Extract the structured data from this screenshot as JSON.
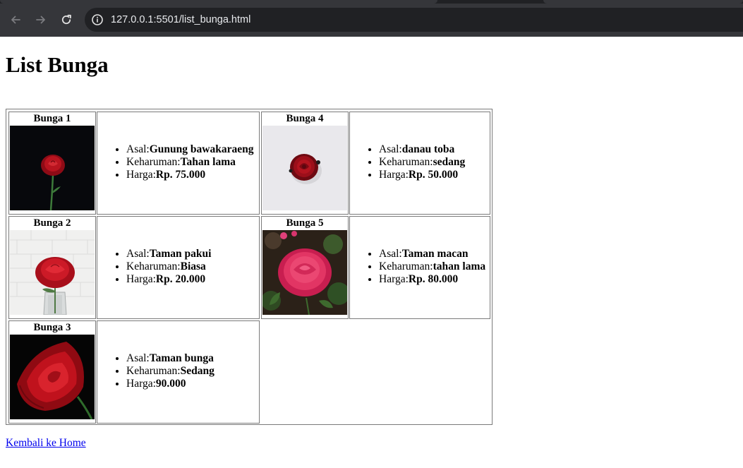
{
  "browser": {
    "url": "127.0.0.1:5501/list_bunga.html"
  },
  "page": {
    "title": "List Bunga",
    "home_link": "Kembali ke Home"
  },
  "labels": {
    "origin": "Asal:",
    "fragrance": "Keharuman:",
    "price": "Harga:"
  },
  "flowers": [
    {
      "name": "Bunga 1",
      "origin": "Gunung bawakaraeng",
      "fragrance": "Tahan lama",
      "price": "Rp. 75.000"
    },
    {
      "name": "Bunga 2",
      "origin": "Taman pakui",
      "fragrance": "Biasa",
      "price": "Rp. 20.000"
    },
    {
      "name": "Bunga 3",
      "origin": "Taman bunga",
      "fragrance": "Sedang",
      "price": "90.000"
    },
    {
      "name": "Bunga 4",
      "origin": "danau toba",
      "fragrance": "sedang",
      "price": "Rp. 50.000"
    },
    {
      "name": "Bunga 5",
      "origin": "Taman macan",
      "fragrance": "tahan lama",
      "price": "Rp. 80.000"
    }
  ]
}
